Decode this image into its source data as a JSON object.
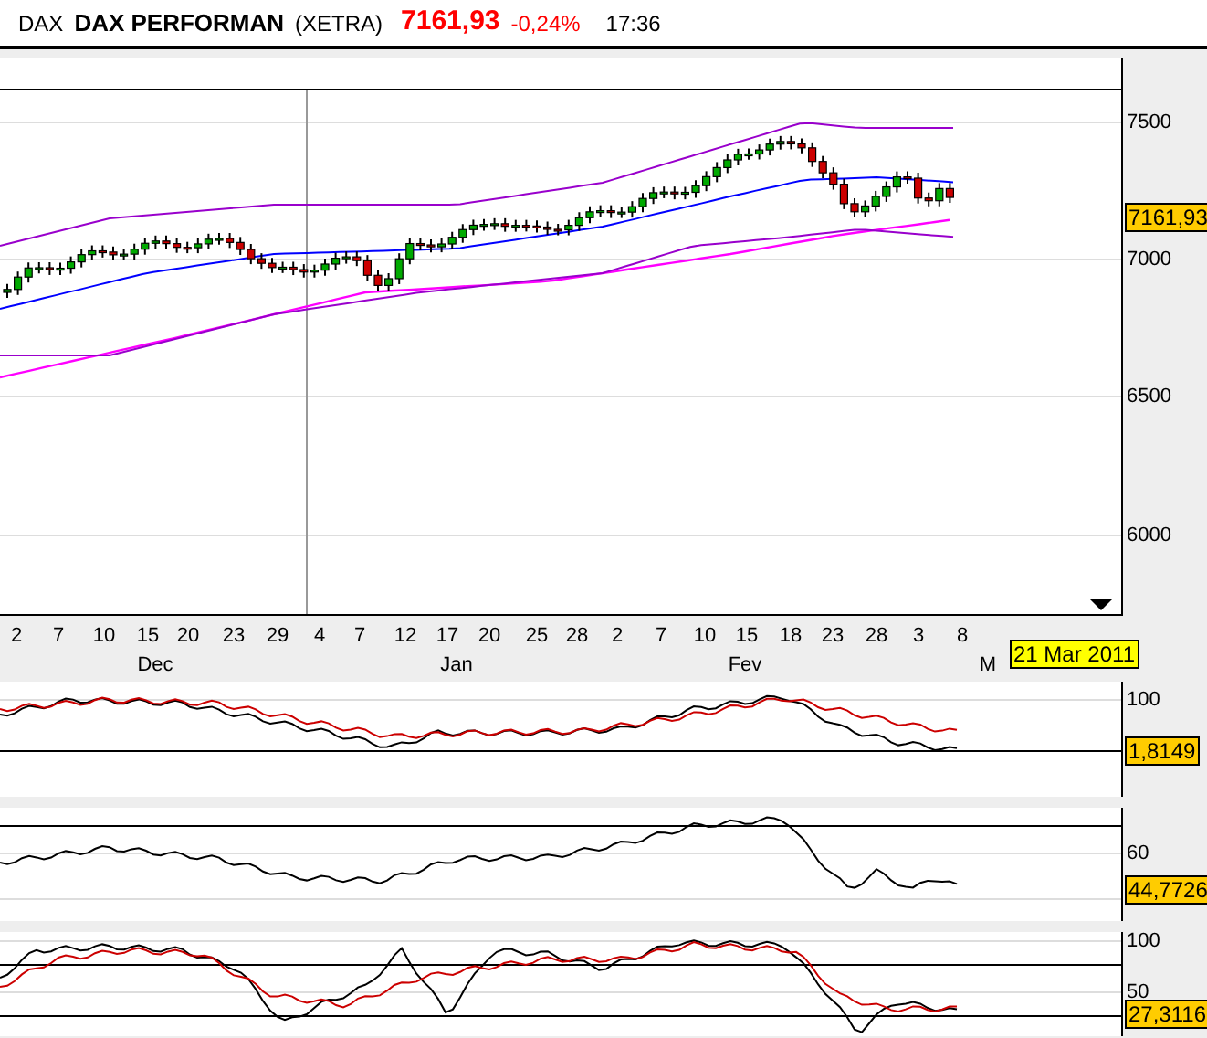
{
  "header": {
    "symbol": "DAX",
    "name": "DAX PERFORMAN",
    "exchange": "(XETRA)",
    "price": "7161,93",
    "change": "-0,24%",
    "time": "17:36"
  },
  "main_chart": {
    "y_ticks": [
      "7500",
      "7000",
      "6500",
      "6000"
    ],
    "price_tag": "7161,93",
    "x_ticks": [
      "2",
      "7",
      "10",
      "15",
      "20",
      "23",
      "29",
      "4",
      "7",
      "12",
      "17",
      "20",
      "25",
      "28",
      "2",
      "7",
      "10",
      "15",
      "18",
      "23",
      "28",
      "3",
      "8"
    ],
    "months": [
      "Dec",
      "Jan",
      "Fev",
      "M"
    ],
    "date_tag": "21 Mar 2011"
  },
  "indicators": [
    {
      "kind": "macd",
      "ticks": [
        "100"
      ],
      "value_tag": "1,8149"
    },
    {
      "kind": "rsi",
      "ticks": [
        "60"
      ],
      "value_tag": "44,7726"
    },
    {
      "kind": "stochastic",
      "ticks": [
        "100",
        "50"
      ],
      "value_tag": "27,3116"
    }
  ]
}
